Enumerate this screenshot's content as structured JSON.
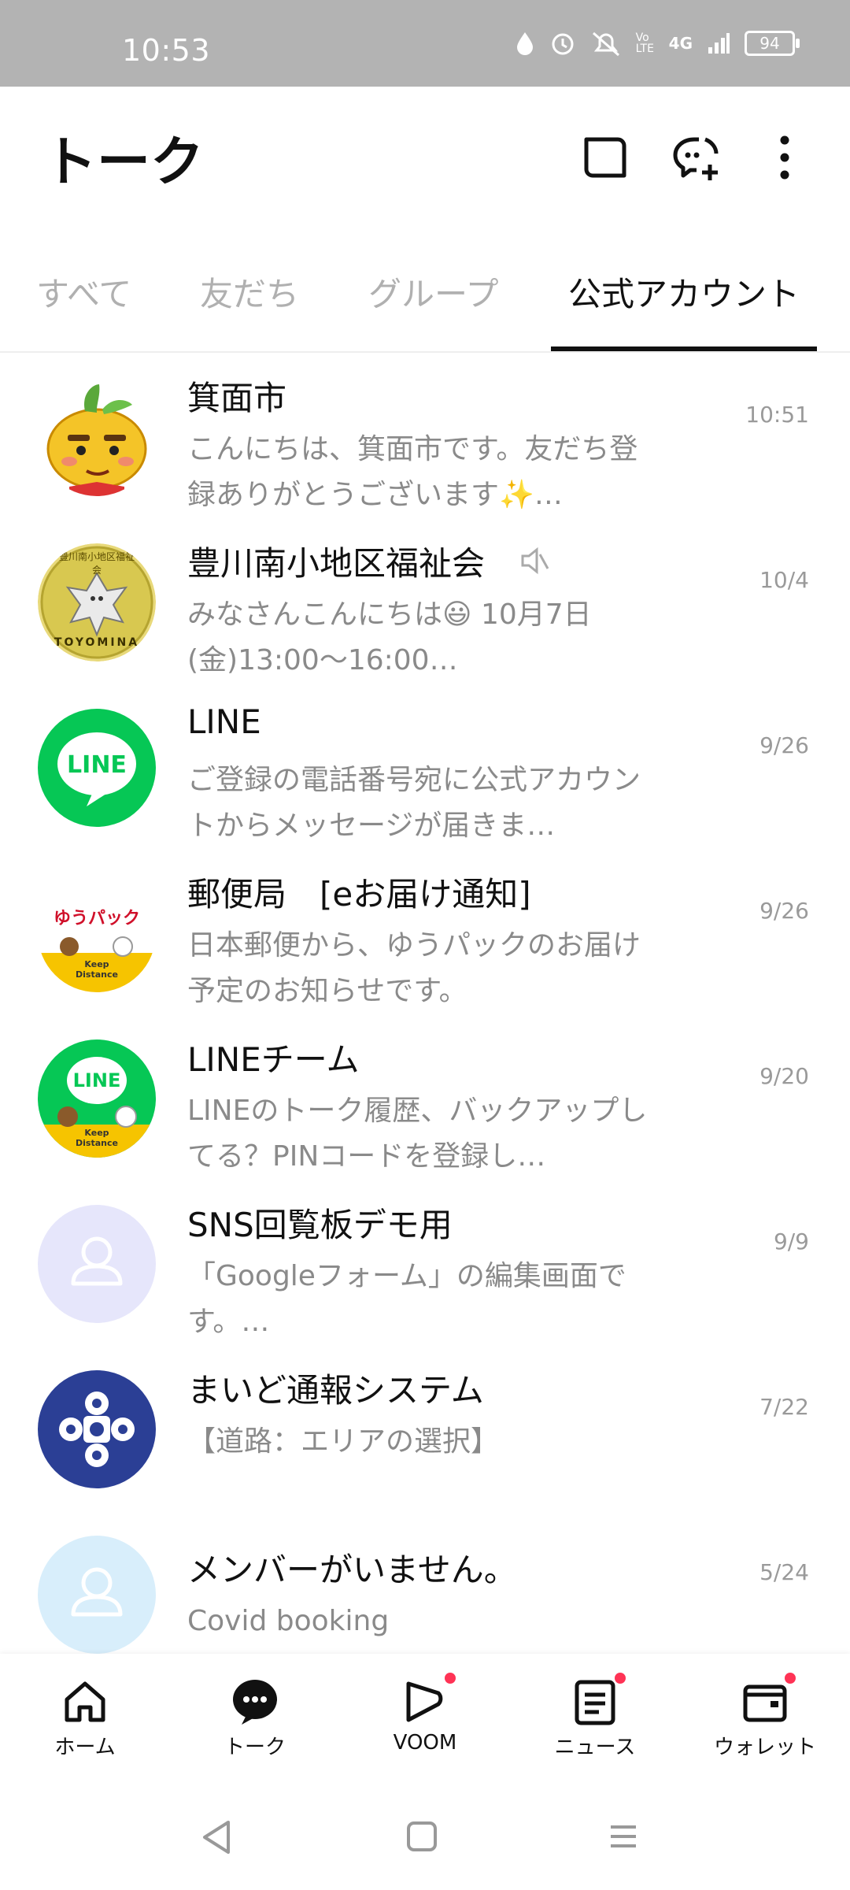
{
  "status": {
    "time": "10:53",
    "battery": "94",
    "network": "4G",
    "volte": "Vo LTE"
  },
  "header": {
    "title": "トーク"
  },
  "tabs": [
    {
      "label": "すべて",
      "active": false
    },
    {
      "label": "友だち",
      "active": false
    },
    {
      "label": "グループ",
      "active": false
    },
    {
      "label": "公式アカウント",
      "active": true
    }
  ],
  "chats": [
    {
      "name": "箕面市",
      "message": "こんにちは、箕面市です。友だち登録ありがとうございます✨…",
      "date": "10:51",
      "avatar": "minoh-mascot"
    },
    {
      "name": "豊川南小地区福祉会",
      "message": "みなさんこんにちは😃 10月7日(金)13:00〜16:00…",
      "date": "10/4",
      "avatar": "toyomina-badge",
      "muted": true,
      "badge_text_top": "豊川南小地区福祉会",
      "badge_text_bottom": "TOYOMINA"
    },
    {
      "name": "LINE",
      "message": "ご登録の電話番号宛に公式アカウントからメッセージが届きま…",
      "date": "9/26",
      "avatar": "line-logo",
      "logo_text": "LINE"
    },
    {
      "name": "郵便局　[eお届け通知]",
      "message": "日本郵便から、ゆうパックのお届け予定のお知らせです。",
      "date": "9/26",
      "avatar": "yupack",
      "logo_text": "ゆうパック",
      "sub_text": "Keep Distance"
    },
    {
      "name": "LINEチーム",
      "message": "LINEのトーク履歴、バックアップしてる？PINコードを登録し…",
      "date": "9/20",
      "avatar": "line-team",
      "logo_text": "LINE",
      "sub_text": "Keep Distance"
    },
    {
      "name": "SNS回覧板デモ用",
      "message": "「Googleフォーム」の編集画面です。…",
      "date": "9/9",
      "avatar": "default-lavender"
    },
    {
      "name": "まいど通報システム",
      "message": "【道路：エリアの選択】",
      "date": "7/22",
      "avatar": "osaka-emblem"
    },
    {
      "name": "メンバーがいません。",
      "message": "Covid booking",
      "date": "5/24",
      "avatar": "default-lightblue"
    }
  ],
  "bottom_nav": [
    {
      "label": "ホーム",
      "icon": "home-icon",
      "dot": false
    },
    {
      "label": "トーク",
      "icon": "chat-icon",
      "dot": false
    },
    {
      "label": "VOOM",
      "icon": "voom-icon",
      "dot": true
    },
    {
      "label": "ニュース",
      "icon": "news-icon",
      "dot": true
    },
    {
      "label": "ウォレット",
      "icon": "wallet-icon",
      "dot": true
    }
  ],
  "colors": {
    "accent_dot": "#ff3355",
    "line_green": "#06c755",
    "statusbar": "#b3b3b3"
  }
}
